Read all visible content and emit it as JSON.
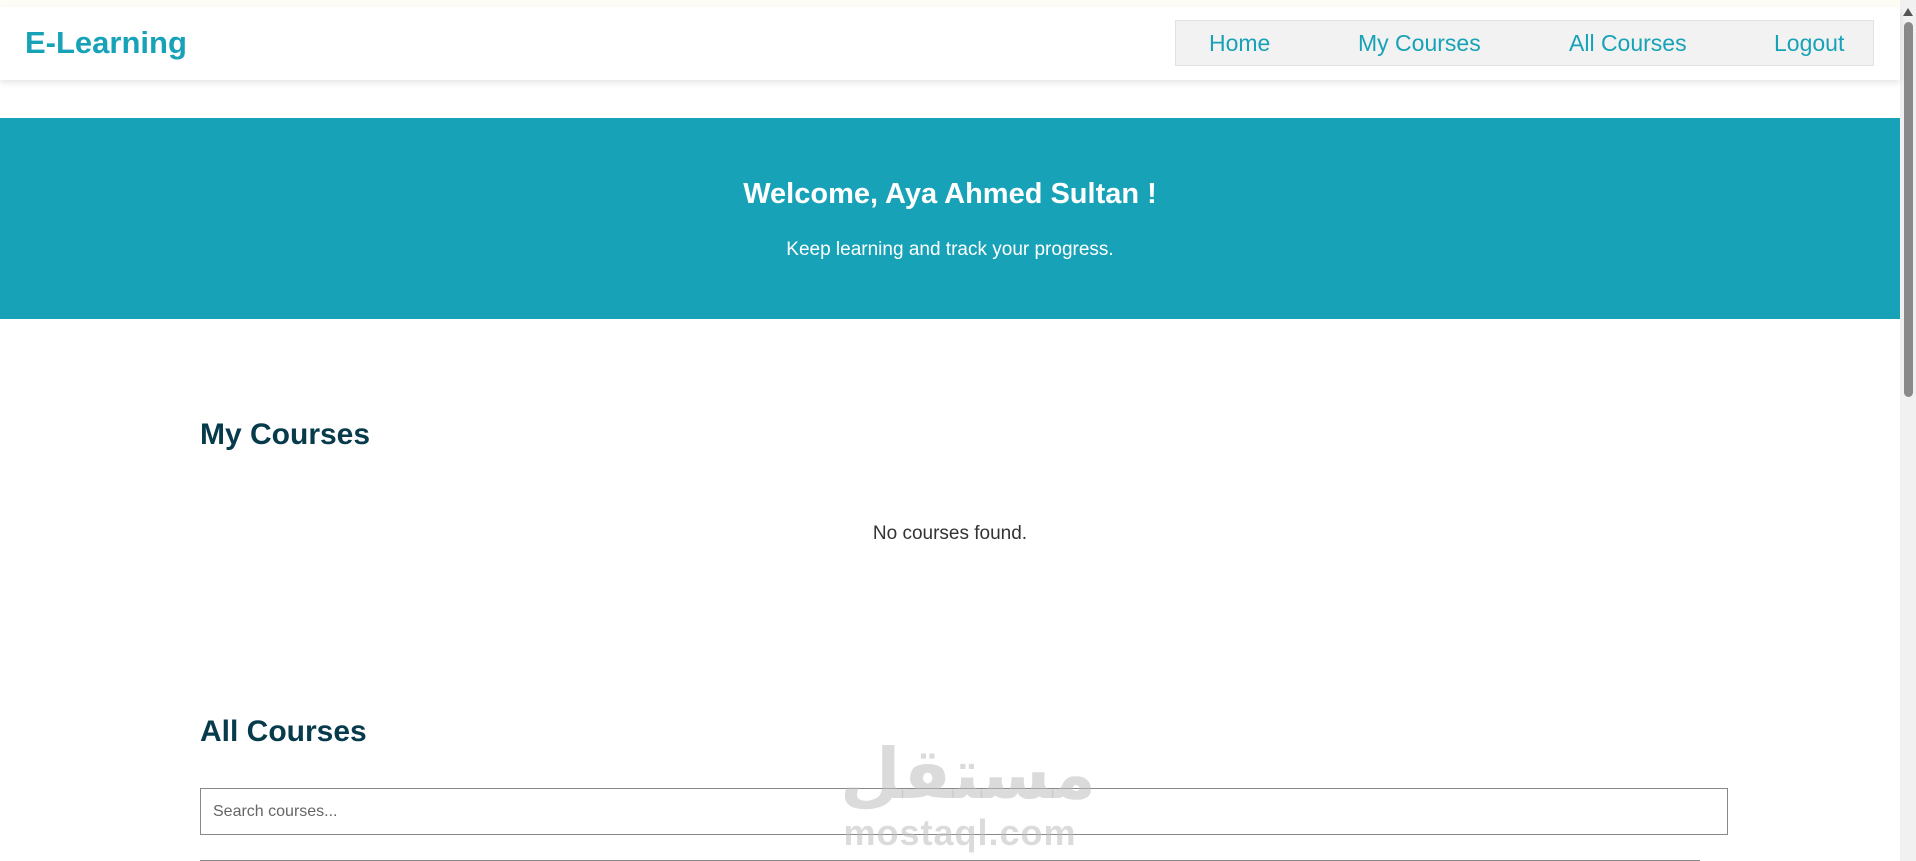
{
  "header": {
    "brand": "E-Learning",
    "nav": [
      {
        "label": "Home"
      },
      {
        "label": "My Courses"
      },
      {
        "label": "All Courses"
      },
      {
        "label": "Logout"
      }
    ]
  },
  "hero": {
    "title": "Welcome, Aya Ahmed Sultan !",
    "subtitle": "Keep learning and track your progress."
  },
  "my_courses": {
    "title": "My Courses",
    "empty_message": "No courses found."
  },
  "all_courses": {
    "title": "All Courses",
    "search_placeholder": "Search courses..."
  },
  "watermark": {
    "glyph": "مستقل",
    "text": "mostaql.com"
  },
  "colors": {
    "accent": "#17a2b8",
    "heading": "#073b4c"
  }
}
